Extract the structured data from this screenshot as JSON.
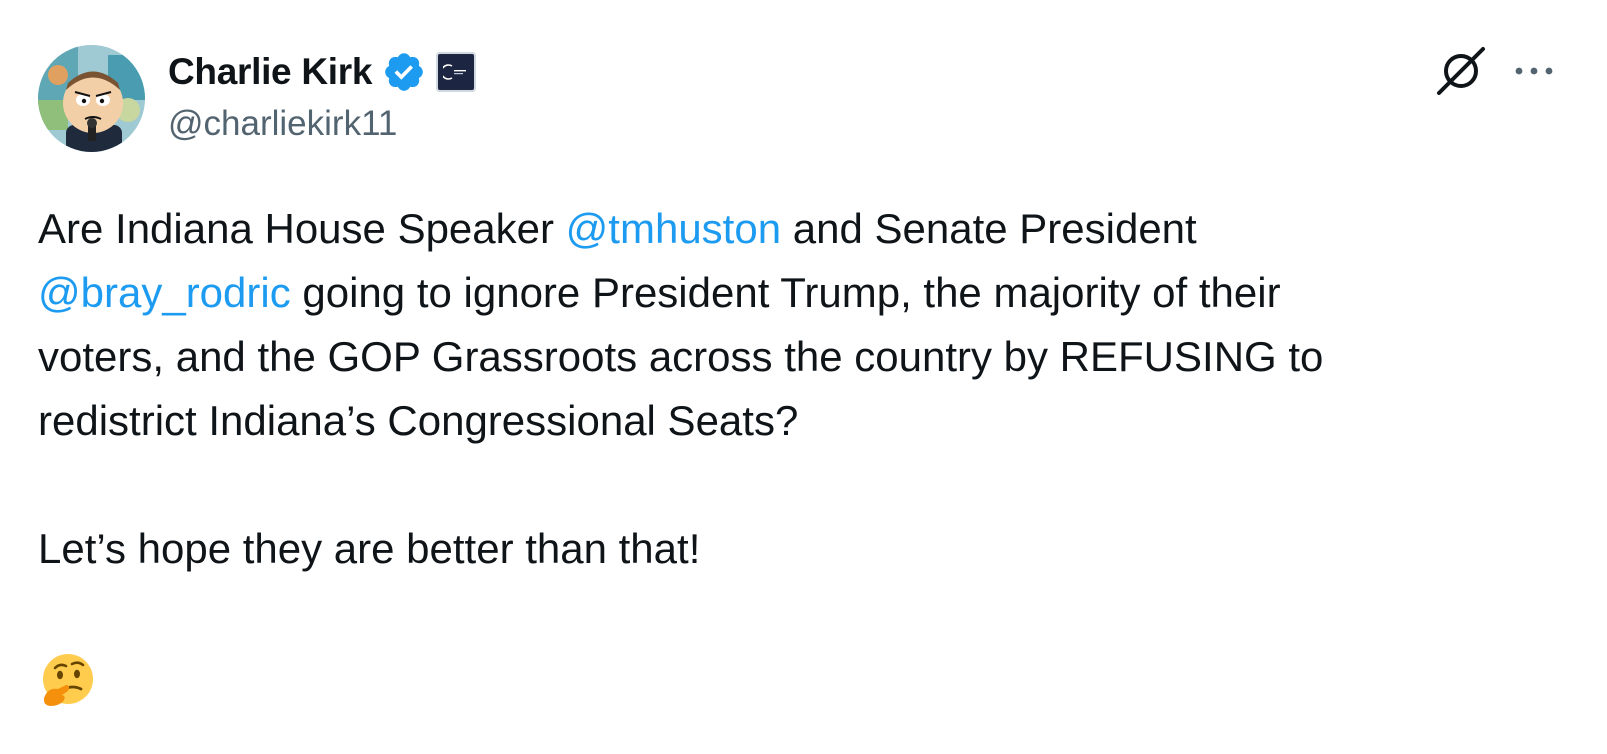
{
  "author": {
    "display_name": "Charlie Kirk",
    "handle": "@charliekirk11",
    "verified": true,
    "avatar_icon": "cartoon-avatar-icon",
    "affiliate_badge_icon": "organization-affiliate-badge-icon"
  },
  "actions": {
    "grok_icon": "grok-slash-icon",
    "more_icon": "more-ellipsis-icon"
  },
  "tweet": {
    "line1_part1": "Are Indiana House Speaker ",
    "mention1": "@tmhuston",
    "line1_part2": " and Senate President",
    "mention2": "@bray_rodric",
    "line2_part2": " going to ignore President Trump, the majority of their",
    "line3": "voters, and the GOP Grassroots across the country by REFUSING to",
    "line4": "redistrict Indiana’s Congressional Seats?",
    "line5": "Let’s hope they are better than that!",
    "emoji": "thinking-face-emoji"
  },
  "colors": {
    "text": "#0f1419",
    "secondary": "#536471",
    "link": "#1d9bf0",
    "verified": "#1d9bf0"
  }
}
